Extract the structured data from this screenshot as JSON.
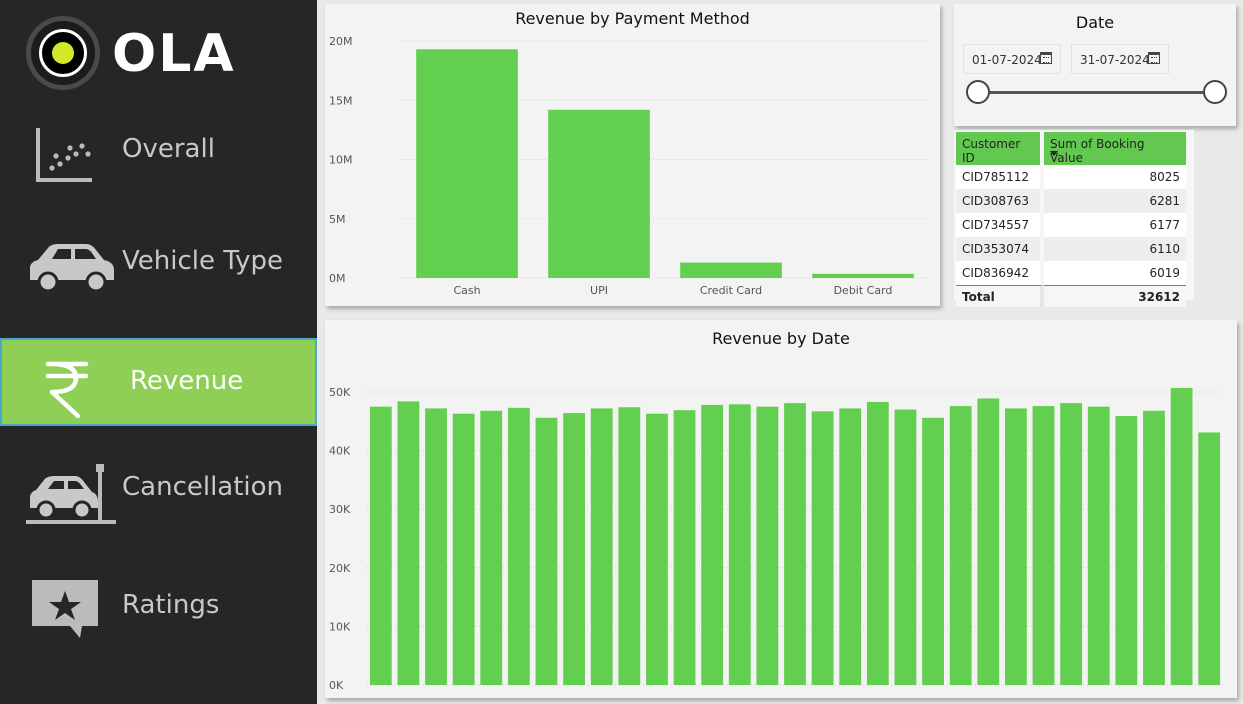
{
  "brand": {
    "logo_text": "OLA"
  },
  "sidebar": {
    "items": [
      {
        "label": "Overall",
        "icon": "scatter-chart-icon"
      },
      {
        "label": "Vehicle Type",
        "icon": "car-icon"
      },
      {
        "label": "Revenue",
        "icon": "rupee-icon",
        "active": true
      },
      {
        "label": "Cancellation",
        "icon": "car-crash-icon"
      },
      {
        "label": "Ratings",
        "icon": "star-speech-bubble-icon"
      }
    ]
  },
  "date_slicer": {
    "title": "Date",
    "start": "01-07-2024",
    "end": "31-07-2024"
  },
  "booking_table": {
    "headers": [
      "Customer ID",
      "Sum of Booking Value"
    ],
    "rows": [
      [
        "CID785112",
        "8025"
      ],
      [
        "CID308763",
        "6281"
      ],
      [
        "CID734557",
        "6177"
      ],
      [
        "CID353074",
        "6110"
      ],
      [
        "CID836942",
        "6019"
      ]
    ],
    "total_label": "Total",
    "total_value": "32612"
  },
  "colors": {
    "bar": "#63cf50",
    "sidebar_bg": "#262626",
    "active_nav": "#8fcf55"
  },
  "chart_data": [
    {
      "type": "bar",
      "title": "Revenue by Payment Method",
      "categories": [
        "Cash",
        "UPI",
        "Credit Card",
        "Debit Card"
      ],
      "values": [
        19300000,
        14200000,
        1300000,
        350000
      ],
      "ylim": [
        0,
        20000000
      ],
      "yticks": [
        "0M",
        "5M",
        "10M",
        "15M",
        "20M"
      ],
      "grid": true
    },
    {
      "type": "bar",
      "title": "Revenue by Date",
      "values": [
        47500,
        48400,
        47200,
        46300,
        46800,
        47300,
        45600,
        46400,
        47200,
        47400,
        46300,
        46900,
        47800,
        47900,
        47500,
        48100,
        46700,
        47200,
        48300,
        47000,
        45600,
        47600,
        48900,
        47200,
        47600,
        48100,
        47500,
        45900,
        46800,
        50700,
        43100
      ],
      "ylim": [
        0,
        50000
      ],
      "yticks": [
        "0K",
        "10K",
        "20K",
        "30K",
        "40K",
        "50K"
      ],
      "grid": true
    }
  ]
}
